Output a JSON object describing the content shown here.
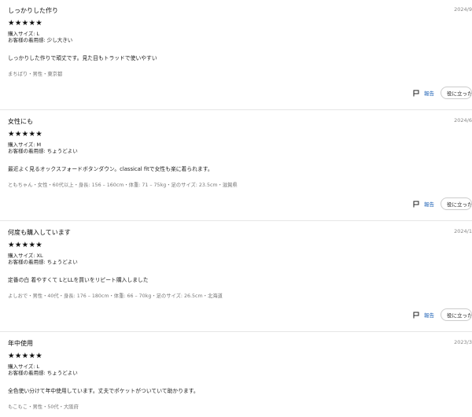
{
  "labels": {
    "size_prefix": "購入サイズ: ",
    "fit_prefix": "お客様の着用感: ",
    "report": "報告",
    "helpful": "役に立った"
  },
  "reviews": [
    {
      "title": "しっかりした作り",
      "date": "2024/9",
      "stars": "★★★★★",
      "rating": 5,
      "size": "購入サイズ: L",
      "fit": "お客様の着用感: 少し大きい",
      "body": "しっかりした作りで頑丈です。見た目もトラッドで使いやすい",
      "reviewer": "まちばり・男性・東京都"
    },
    {
      "title": "女性にも",
      "date": "2024/6",
      "stars": "★★★★★",
      "rating": 5,
      "size": "購入サイズ: M",
      "fit": "お客様の着用感: ちょうどよい",
      "body": "最近よく見るオックスフォードボタンダウン。classical fitで女性も楽に着られます。",
      "reviewer": "ともちゃん・女性・60代以上・身長: 156 – 160cm・体重: 71 – 75kg・足のサイズ: 23.5cm・滋賀県"
    },
    {
      "title": "何度も購入しています",
      "date": "2024/1",
      "stars": "★★★★★",
      "rating": 5,
      "size": "購入サイズ: XL",
      "fit": "お客様の着用感: ちょうどよい",
      "body": "定番の白 着やすくて LとLLを買いをリピート購入しました",
      "reviewer": "よしおで・男性・40代・身長: 176 – 180cm・体重: 66 – 70kg・足のサイズ: 26.5cm・北海道"
    },
    {
      "title": "年中使用",
      "date": "2023/3",
      "stars": "★★★★★",
      "rating": 5,
      "size": "購入サイズ: L",
      "fit": "お客様の着用感: ちょうどよい",
      "body": "全色使い分けて年中使用しています。丈夫でポケットがついていて助かります。",
      "reviewer": "もこもこ・男性・50代・大阪府"
    }
  ]
}
